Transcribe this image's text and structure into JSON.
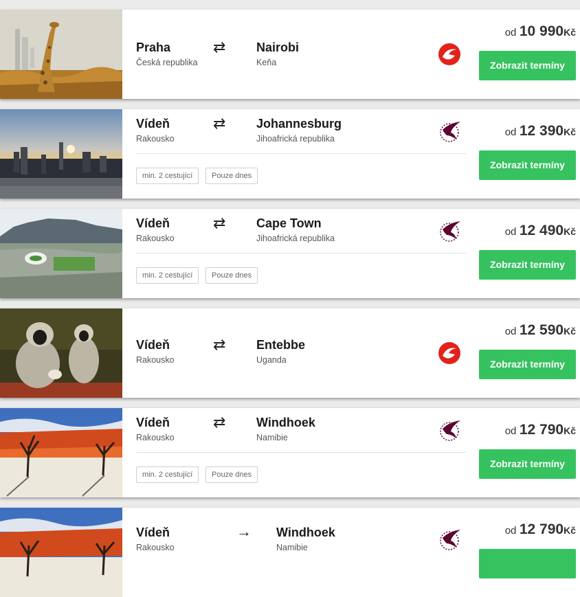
{
  "offers": [
    {
      "from_city": "Praha",
      "from_country": "Česká republika",
      "to_city": "Nairobi",
      "to_country": "Keňa",
      "trip_arrow": "⇄",
      "airline_icon": "turkish-airlines-logo",
      "price_prefix": "od",
      "price_amount": "10 990",
      "price_currency": "Kč",
      "button_label": "Zobrazit termíny",
      "tags": [],
      "photo": "giraffe-photo"
    },
    {
      "from_city": "Vídeň",
      "from_country": "Rakousko",
      "to_city": "Johannesburg",
      "to_country": "Jihoafrická republika",
      "trip_arrow": "⇄",
      "airline_icon": "qatar-airways-logo",
      "price_prefix": "od",
      "price_amount": "12 390",
      "price_currency": "Kč",
      "button_label": "Zobrazit termíny",
      "tags": [
        "min. 2 cestující",
        "Pouze dnes"
      ],
      "photo": "city-skyline-photo"
    },
    {
      "from_city": "Vídeň",
      "from_country": "Rakousko",
      "to_city": "Cape Town",
      "to_country": "Jihoafrická republika",
      "trip_arrow": "⇄",
      "airline_icon": "qatar-airways-logo",
      "price_prefix": "od",
      "price_amount": "12 490",
      "price_currency": "Kč",
      "button_label": "Zobrazit termíny",
      "tags": [
        "min. 2 cestující",
        "Pouze dnes"
      ],
      "photo": "cape-town-photo"
    },
    {
      "from_city": "Vídeň",
      "from_country": "Rakousko",
      "to_city": "Entebbe",
      "to_country": "Uganda",
      "trip_arrow": "⇄",
      "airline_icon": "turkish-airlines-logo",
      "price_prefix": "od",
      "price_amount": "12 590",
      "price_currency": "Kč",
      "button_label": "Zobrazit termíny",
      "tags": [],
      "photo": "monkeys-photo"
    },
    {
      "from_city": "Vídeň",
      "from_country": "Rakousko",
      "to_city": "Windhoek",
      "to_country": "Namibie",
      "trip_arrow": "⇄",
      "airline_icon": "qatar-airways-logo",
      "price_prefix": "od",
      "price_amount": "12 790",
      "price_currency": "Kč",
      "button_label": "Zobrazit termíny",
      "tags": [
        "min. 2 cestující",
        "Pouze dnes"
      ],
      "photo": "desert-trees-photo"
    },
    {
      "from_city": "Vídeň",
      "from_country": "Rakousko",
      "to_city": "Windhoek",
      "to_country": "Namibie",
      "trip_arrow": "→",
      "airline_icon": "qatar-airways-logo",
      "price_prefix": "od",
      "price_amount": "12 790",
      "price_currency": "Kč",
      "button_label": "",
      "tags": [],
      "photo": "desert-trees-photo"
    }
  ],
  "colors": {
    "accent": "#35c25f",
    "turkish": "#e2231a",
    "qatar": "#5c0632"
  }
}
